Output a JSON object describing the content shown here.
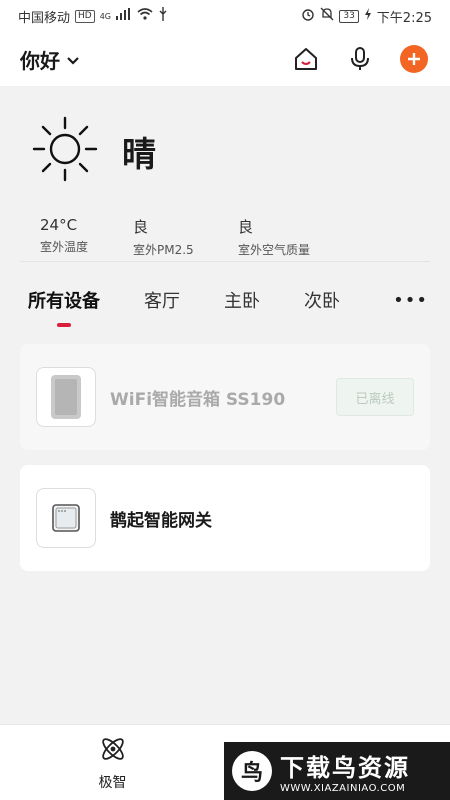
{
  "status_bar": {
    "carrier": "中国移动",
    "hd": "HD",
    "network": "4G",
    "battery": "33",
    "time": "下午2:25"
  },
  "header": {
    "greeting": "你好",
    "icons": [
      "home-icon",
      "microphone-icon",
      "add-icon"
    ],
    "accent_color": "#f26522"
  },
  "weather": {
    "condition": "晴",
    "icon": "sun-icon",
    "stats": [
      {
        "value": "24°C",
        "label": "室外温度"
      },
      {
        "value": "良",
        "label": "室外PM2.5"
      },
      {
        "value": "良",
        "label": "室外空气质量"
      }
    ]
  },
  "tabs": {
    "items": [
      "所有设备",
      "客厅",
      "主卧",
      "次卧"
    ],
    "active_index": 0,
    "indicator_color": "#d81e3c"
  },
  "devices": [
    {
      "name": "WiFi智能音箱 SS190",
      "status": "已离线",
      "icon": "speaker-icon",
      "online": false
    },
    {
      "name": "鹊起智能网关",
      "icon": "gateway-icon",
      "online": true
    }
  ],
  "bottom_nav": {
    "items": [
      {
        "label": "极智",
        "icon": "atom-icon"
      },
      {
        "label": "",
        "icon": "profile-icon"
      }
    ]
  },
  "watermark": {
    "title": "下载鸟资源",
    "url": "WWW.XIAZAINIAO.COM"
  }
}
